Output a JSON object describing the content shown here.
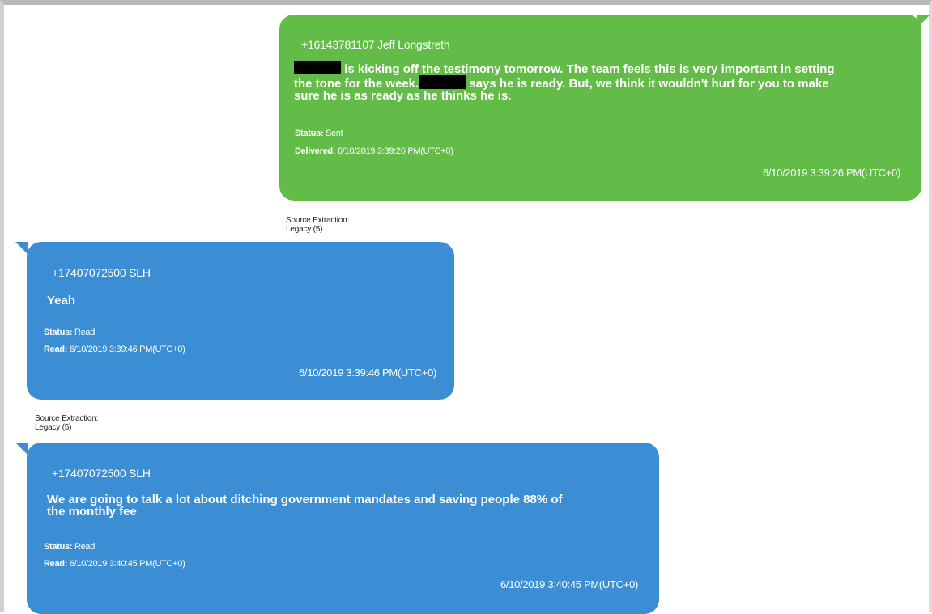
{
  "messages": [
    {
      "sender": "+16143781107 Jeff Longstreth",
      "text_lines": [
        "is kicking off the testimony tomorrow. The team feels this is very important in setting",
        "the tone for the week.",
        "says he is ready. But, we think it wouldn't hurt for you to make",
        "sure he is as ready as he thinks he is."
      ],
      "status_label": "Status:",
      "status_value": "Sent",
      "detail_label": "Delivered:",
      "detail_value": "6/10/2019 3:39:26 PM(UTC+0)",
      "timestamp": "6/10/2019 3:39:26 PM(UTC+0)",
      "color": "#63bb48"
    },
    {
      "sender": "+17407072500 SLH",
      "text_lines": [
        "Yeah"
      ],
      "status_label": "Status:",
      "status_value": "Read",
      "detail_label": "Read:",
      "detail_value": "6/10/2019 3:39:46 PM(UTC+0)",
      "timestamp": "6/10/2019 3:39:46 PM(UTC+0)",
      "color": "#3b8ed3"
    },
    {
      "sender": "+17407072500 SLH",
      "text_lines": [
        "We are going to talk a lot about ditching government mandates and saving people 88% of",
        "the monthly fee"
      ],
      "status_label": "Status:",
      "status_value": "Read",
      "detail_label": "Read:",
      "detail_value": "6/10/2019 3:40:45 PM(UTC+0)",
      "timestamp": "6/10/2019 3:40:45 PM(UTC+0)",
      "color": "#3b8ed3"
    }
  ],
  "sources": [
    {
      "label": "Source Extraction:",
      "value": "Legacy (5)"
    },
    {
      "label": "Source Extraction:",
      "value": "Legacy (5)"
    }
  ]
}
